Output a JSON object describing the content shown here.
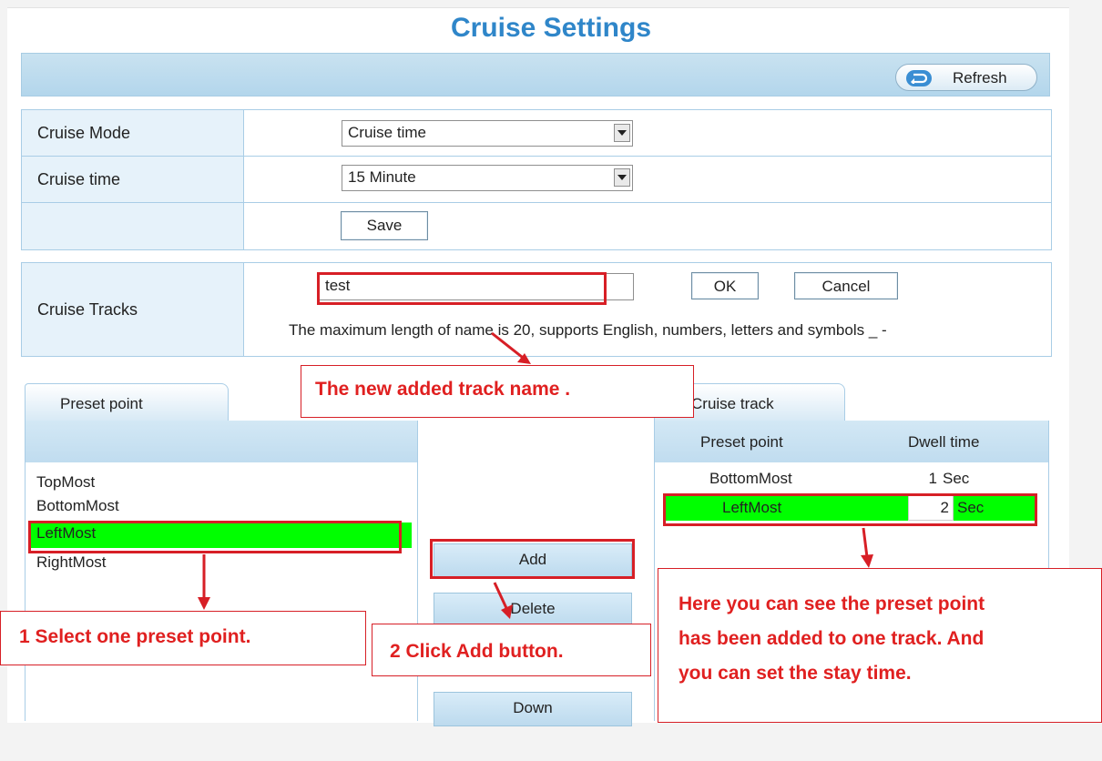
{
  "page": {
    "title": "Cruise Settings"
  },
  "header": {
    "refresh_label": "Refresh"
  },
  "settings": {
    "cruise_mode": {
      "label": "Cruise Mode",
      "value": "Cruise time"
    },
    "cruise_time": {
      "label": "Cruise time",
      "value": "15 Minute"
    },
    "save_label": "Save"
  },
  "tracks": {
    "label": "Cruise Tracks",
    "input_value": "test",
    "ok_label": "OK",
    "cancel_label": "Cancel",
    "hint": "The maximum length of name is 20, supports English, numbers, letters and symbols _ -"
  },
  "preset_panel": {
    "tab_label": "Preset point",
    "items": [
      "TopMost",
      "BottomMost",
      "LeftMost",
      "RightMost"
    ],
    "selected": "LeftMost"
  },
  "buttons": {
    "add": "Add",
    "delete": "Delete",
    "down": "Down"
  },
  "cruise_track_panel": {
    "tab_label": "Cruise track",
    "col_preset": "Preset point",
    "col_dwell": "Dwell time",
    "rows": [
      {
        "preset": "BottomMost",
        "dwell": "1",
        "unit": "Sec"
      },
      {
        "preset": "LeftMost",
        "dwell": "2",
        "unit": "Sec"
      }
    ]
  },
  "annotations": {
    "new_track_name": "The new added track name .",
    "step1": "1 Select one preset point.",
    "step2": "2 Click Add button.",
    "result_line1": "Here you can see the preset point",
    "result_line2": "has been added to one track. And",
    "result_line3": "you can set the stay time."
  },
  "colors": {
    "accent": "#2f86c9",
    "highlight": "#00ff00",
    "annotation_red": "#d71f26"
  }
}
